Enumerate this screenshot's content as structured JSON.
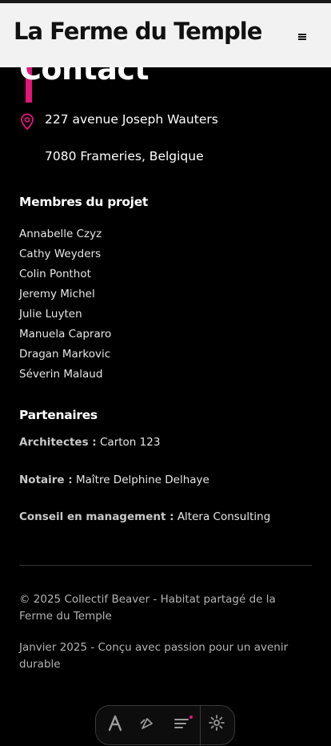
{
  "header": {
    "brand": "La Ferme du Temple",
    "menu_icon": "hamburger-menu-icon"
  },
  "page": {
    "title": "Contact"
  },
  "address": {
    "icon": "location-pin-icon",
    "line1": "227 avenue Joseph Wauters",
    "line2": "7080 Frameries, Belgique"
  },
  "members": {
    "heading": "Membres du projet",
    "items": [
      "Annabelle Czyz",
      "Cathy Weyders",
      "Colin Ponthot",
      "Jeremy Michel",
      "Julie Luyten",
      "Manuela Capraro",
      "Dragan Markovic",
      "Séverin Malaud"
    ]
  },
  "partners": {
    "heading": "Partenaires",
    "items": [
      {
        "label": "Architectes :",
        "value": "Carton 123"
      },
      {
        "label": "Notaire :",
        "value": "Maître Delphine Delhaye"
      },
      {
        "label": "Conseil en management :",
        "value": "Altera Consulting"
      }
    ]
  },
  "footer": {
    "copyright": "© 2025 Collectif Beaver - Habitat partagé de la Ferme du Temple",
    "tagline": "Janvier 2025 - Conçu avec passion pour un avenir durable"
  },
  "accessibility_toolbar": {
    "icons": [
      "text-size-icon",
      "contrast-icon",
      "filters-icon",
      "settings-gear-icon"
    ]
  },
  "colors": {
    "accent": "#e5157a",
    "background": "#000000",
    "header_bg": "#f2f2f2"
  }
}
